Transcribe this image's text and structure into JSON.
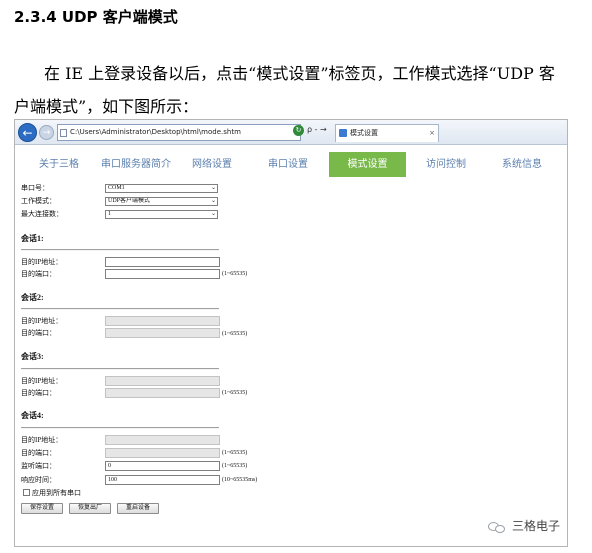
{
  "heading": "2.3.4 UDP 客户端模式",
  "paragraph": {
    "line1": "在 IE 上登录设备以后，点击“模式设置”标签页，工作模式选择“UDP 客",
    "line2": "户端模式”，如下图所示："
  },
  "browser": {
    "address": "C:\\Users\\Administrator\\Desktop\\html\\mode.shtm",
    "search_glyph": "ρ - →",
    "tab_title": "模式设置",
    "tab_close": "×"
  },
  "nav": {
    "items": [
      "关于三格",
      "串口服务器简介",
      "网络设置",
      "串口设置",
      "模式设置",
      "访问控制",
      "系统信息"
    ],
    "active_index": 4,
    "active_color": "#79b94a",
    "text_color": "#5a7fae"
  },
  "form": {
    "serial_port_label": "串口号：",
    "serial_port_value": "COM1",
    "work_mode_label": "工作模式：",
    "work_mode_value": "UDP客户端模式",
    "max_conn_label": "最大连接数：",
    "max_conn_value": "1",
    "sessions": [
      {
        "title": "会话1:",
        "ip_label": "目的IP地址：",
        "port_label": "目的端口：",
        "port_hint": "(1~65535)",
        "enabled": true
      },
      {
        "title": "会话2:",
        "ip_label": "目的IP地址：",
        "port_label": "目的端口：",
        "port_hint": "(1~65535)",
        "enabled": false
      },
      {
        "title": "会话3:",
        "ip_label": "目的IP地址：",
        "port_label": "目的端口：",
        "port_hint": "(1~65535)",
        "enabled": false
      },
      {
        "title": "会话4:",
        "ip_label": "目的IP地址：",
        "port_label": "目的端口：",
        "port_hint": "(1~65535)",
        "enabled": false
      }
    ],
    "listen_port_label": "监听端口：",
    "listen_port_value": "0",
    "listen_port_hint": "(1~65535)",
    "response_time_label": "响应时间：",
    "response_time_value": "100",
    "response_time_hint": "(10~65535ms)",
    "apply_all_label": "应用到所有串口",
    "buttons": {
      "save": "保存设置",
      "factory": "恢复出厂",
      "restart": "重启设备"
    }
  },
  "watermark": "三格电子"
}
